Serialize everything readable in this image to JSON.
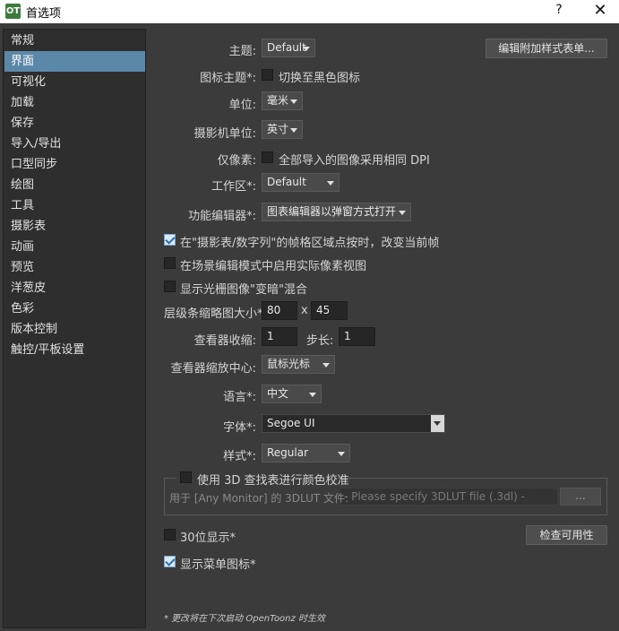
{
  "window": {
    "app_icon": "OT",
    "title": "首选项",
    "help": "?",
    "close": "✕"
  },
  "sidebar": {
    "items": [
      "常规",
      "界面",
      "可视化",
      "加载",
      "保存",
      "导入/导出",
      "口型同步",
      "绘图",
      "工具",
      "摄影表",
      "动画",
      "预览",
      "洋葱皮",
      "色彩",
      "版本控制",
      "触控/平板设置"
    ],
    "active": "界面"
  },
  "form": {
    "theme_label": "主题:",
    "theme_value": "Default",
    "edit_stylesheet_button": "编辑附加样式表单...",
    "icon_theme_label": "图标主题*:",
    "icon_theme_check": "切换至黑色图标",
    "unit_label": "单位:",
    "unit_value": "毫米",
    "camera_unit_label": "摄影机单位:",
    "camera_unit_value": "英寸",
    "pixel_only_label": "仅像素:",
    "pixel_only_check": "全部导入的图像采用相同 DPI",
    "workspace_label": "工作区*:",
    "workspace_value": "Default",
    "function_editor_label": "功能编辑器*:",
    "function_editor_value": "图表编辑器以弹窗方式打开",
    "xsheet_click_check": "在\"摄影表/数字列\"的帧格区域点按时，改变当前帧",
    "actual_pixel_check": "在场景编辑模式中启用实际像素视图",
    "raster_darken_check": "显示光栅图像\"变暗\"混合",
    "level_strip_label": "层级条缩略图大小*:",
    "level_strip_w": "80",
    "level_strip_x": "x",
    "level_strip_h": "45",
    "viewer_shrink_label": "查看器收缩:",
    "viewer_shrink_value": "1",
    "step_label": "步长:",
    "step_value": "1",
    "viewer_zoom_label": "查看器缩放中心:",
    "viewer_zoom_value": "鼠标光标",
    "language_label": "语言*:",
    "language_value": "中文",
    "font_label": "字体*:",
    "font_value": "Segoe UI",
    "style_label": "样式*:",
    "style_value": "Regular",
    "lut_check": "使用 3D 查找表进行颜色校准",
    "lut_file_label": "用于 [Any Monitor] 的 3DLUT 文件:",
    "lut_file_placeholder": "- Please specify 3DLUT file (.3dl) -",
    "lut_browse": "...",
    "bit30_check": "30位显示*",
    "check_availability_button": "检查可用性",
    "menu_icons_check": "显示菜单图标*",
    "footnote": "* 更改将在下次启动 OpenToonz 时生效"
  },
  "checks": {
    "icon_theme": false,
    "pixel_only": false,
    "xsheet_click": true,
    "actual_pixel": false,
    "raster_darken": false,
    "lut": false,
    "bit30": false,
    "menu_icons": true
  },
  "colors": {
    "accent": "#5b87a9",
    "panel": "#3b3b3b",
    "sidebar": "#2e2e2e"
  }
}
